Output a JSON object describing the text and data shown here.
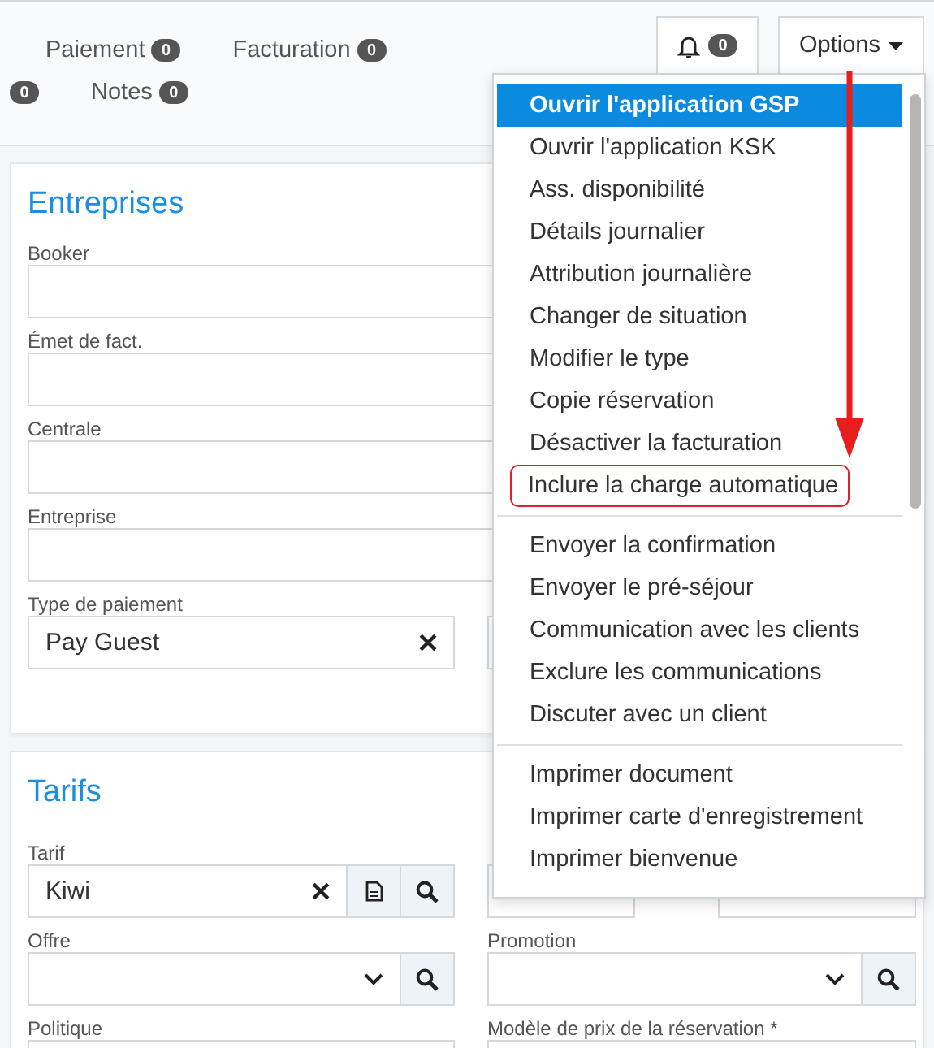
{
  "tabs_row_1": [
    {
      "label": "Paiement",
      "count": "0"
    },
    {
      "label": "Facturation",
      "count": "0"
    }
  ],
  "tabs_row_2": [
    {
      "count": "0"
    },
    {
      "label": "Notes",
      "count": "0"
    }
  ],
  "bell": {
    "count": "0"
  },
  "options_button": {
    "label": "Options"
  },
  "options_menu": {
    "groups": [
      [
        {
          "label": "Ouvrir l'application GSP",
          "selected": true,
          "outlined": false
        },
        {
          "label": "Ouvrir l'application KSK",
          "selected": false,
          "outlined": false
        },
        {
          "label": "Ass. disponibilité",
          "selected": false,
          "outlined": false
        },
        {
          "label": "Détails journalier",
          "selected": false,
          "outlined": false
        },
        {
          "label": "Attribution journalière",
          "selected": false,
          "outlined": false
        },
        {
          "label": "Changer de situation",
          "selected": false,
          "outlined": false
        },
        {
          "label": "Modifier le type",
          "selected": false,
          "outlined": false
        },
        {
          "label": "Copie réservation",
          "selected": false,
          "outlined": false
        },
        {
          "label": "Désactiver la facturation",
          "selected": false,
          "outlined": false
        },
        {
          "label": "Inclure la charge automatique",
          "selected": false,
          "outlined": true
        }
      ],
      [
        {
          "label": "Envoyer la confirmation",
          "selected": false,
          "outlined": false
        },
        {
          "label": "Envoyer le pré-séjour",
          "selected": false,
          "outlined": false
        },
        {
          "label": "Communication avec les clients",
          "selected": false,
          "outlined": false
        },
        {
          "label": "Exclure les communications",
          "selected": false,
          "outlined": false
        },
        {
          "label": "Discuter avec un client",
          "selected": false,
          "outlined": false
        }
      ],
      [
        {
          "label": "Imprimer document",
          "selected": false,
          "outlined": false
        },
        {
          "label": "Imprimer carte d'enregistrement",
          "selected": false,
          "outlined": false
        },
        {
          "label": "Imprimer bienvenue",
          "selected": false,
          "outlined": false
        }
      ]
    ]
  },
  "entreprises": {
    "title": "Entreprises",
    "fields": [
      {
        "label": "Booker"
      },
      {
        "label": "Émet de fact."
      },
      {
        "label": "Centrale"
      },
      {
        "label": "Entreprise"
      }
    ],
    "payment": {
      "label": "Type de paiement",
      "value": "Pay Guest"
    }
  },
  "tarifs": {
    "title": "Tarifs",
    "tarif": {
      "label": "Tarif",
      "value": "Kiwi"
    },
    "offre": {
      "label": "Offre"
    },
    "politique": {
      "label": "Politique"
    },
    "promotion": {
      "label": "Promotion"
    },
    "price_model": {
      "label": "Modèle de prix de la réservation *"
    }
  }
}
